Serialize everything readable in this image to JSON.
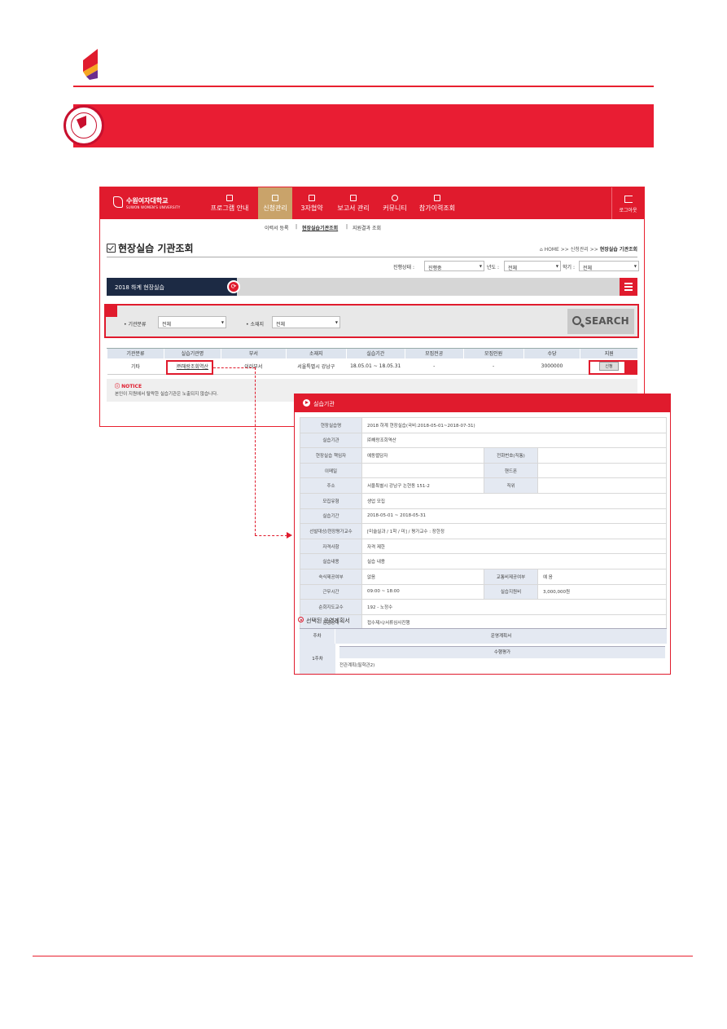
{
  "nav": {
    "brand_name": "수원여자대학교",
    "brand_sub": "SUWON WOMEN'S UNIVERSITY",
    "menu": [
      "프로그램 안내",
      "신청관리",
      "3자협약",
      "보고서 관리",
      "커뮤니티",
      "참가이력조회"
    ],
    "active_index": 1,
    "logout": "로그아웃"
  },
  "subnav": [
    "이력서 등록",
    "|",
    "현장실습기관조회",
    "|",
    "지원결과 조회"
  ],
  "page": {
    "title": "현장실습 기관조회",
    "breadcrumb_home": "HOME",
    "breadcrumb_sep": ">>",
    "breadcrumb_mid": "신청관리",
    "breadcrumb_cur": "현장실습 기관조회"
  },
  "filters": {
    "status_label": "진행상태 :",
    "status_value": "진행중",
    "year_label": "년도 :",
    "year_value": "전체",
    "term_label": "학기 :",
    "term_value": "전체"
  },
  "semester": "2018 하계 현장실습",
  "search": {
    "category_label": "기관분류",
    "category_value": "전체",
    "location_label": "소재지",
    "location_value": "전체",
    "button": "SEARCH"
  },
  "table": {
    "headers": [
      "기관분류",
      "실습기관명",
      "부서",
      "소재지",
      "실습기간",
      "모집전공",
      "모집인원",
      "수당",
      "지원"
    ],
    "rows": [
      [
        "기타",
        "㈜해랑조회역산",
        "이러부서",
        "서울특별시   강남구",
        "18.05.01 ~ 18.05.31",
        "-",
        "-",
        "3000000",
        "신청"
      ]
    ]
  },
  "notice": {
    "title": "NOTICE",
    "text": "본인이 지원에서 탈락한 실습기관은 노출되지 않습니다."
  },
  "detail": {
    "header": "실습기관",
    "rows": [
      {
        "k": "현장실습명",
        "v": "2018 하계 현장실습(국비:2018-05-01~2018-07-31)"
      },
      {
        "k": "실습기관",
        "v": "㈜해랑조회역산"
      },
      {
        "k": "현장실습 책임자",
        "v": "예동렬담자",
        "k2": "전화번호(직통)",
        "v2": ""
      },
      {
        "k": "이메일",
        "v": "",
        "k2": "핸드폰",
        "v2": ""
      },
      {
        "k": "주소",
        "v": "서울특별시 강남구 논현동 151-2",
        "k2": "직위",
        "v2": ""
      },
      {
        "k": "모집유형",
        "v": "생업 모집"
      },
      {
        "k": "실습기간",
        "v": "2018-05-01 ~ 2018-05-31"
      },
      {
        "k": "선발대상/현장평가교수",
        "v": "[미술실과 / 1학 / 미] / 평가교수 : 장한정"
      },
      {
        "k": "자격사항",
        "v": "자격 제한"
      },
      {
        "k": "실습내용",
        "v": "실습 내용"
      },
      {
        "k": "숙식제공여부",
        "v": "없음",
        "k2": "교통비제공여부",
        "v2": "예 음"
      },
      {
        "k": "근무시간",
        "v": "09:00 ~ 18:00",
        "k2": "실습지원비",
        "v2": "3,000,000원"
      },
      {
        "k": "순회지도교수",
        "v": "192 - 노정수"
      },
      {
        "k": "진행상태",
        "v": "접수제시/서류심사진행"
      }
    ],
    "plan_title": "선택된 운영계획서",
    "plan_week_header": "주차",
    "plan_header": "운영계획서",
    "plan_week": "1주차",
    "plan_sub_header": "수행평가",
    "plan_value": "전관계획(필학관2)"
  },
  "colors": {
    "accent": "#e01b2d",
    "brand_gold": "#c9a36a",
    "navy": "#1c2a44"
  }
}
